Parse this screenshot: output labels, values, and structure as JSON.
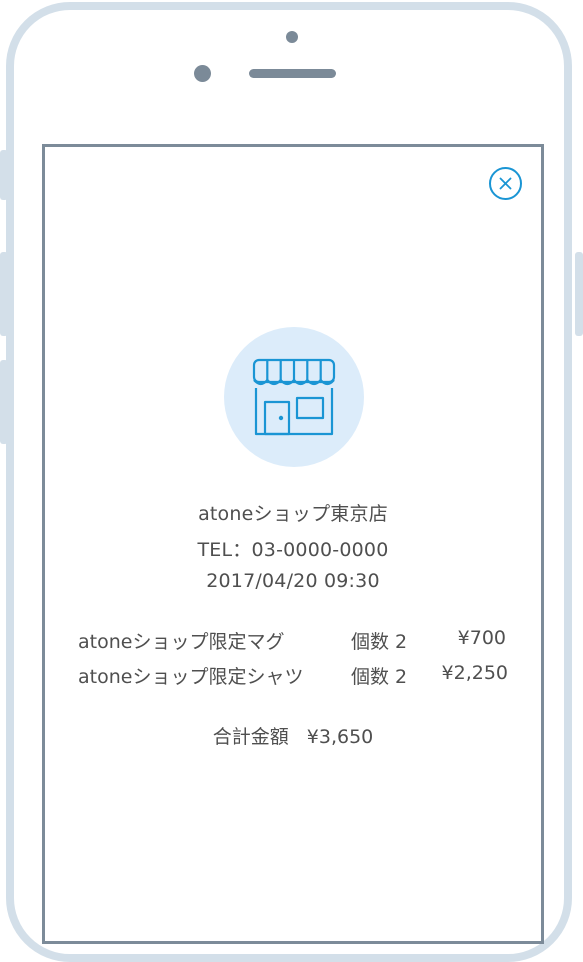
{
  "store": {
    "name": "atoneショップ東京店",
    "tel": "TEL：03-0000-0000",
    "datetime": "2017/04/20 09:30",
    "icon": "store-icon"
  },
  "items": [
    {
      "name": "atoneショップ限定マグ",
      "qty": "個数 2",
      "price": "¥700"
    },
    {
      "name": "atoneショップ限定シャツ",
      "qty": "個数 2",
      "price": "¥2,250"
    }
  ],
  "total": {
    "label": "合計金額",
    "amount": "¥3,650"
  },
  "colors": {
    "accent": "#1a95d4",
    "icon_bg": "#dcecfa",
    "frame": "#d3dfe9",
    "screen_border": "#7c8b99"
  }
}
